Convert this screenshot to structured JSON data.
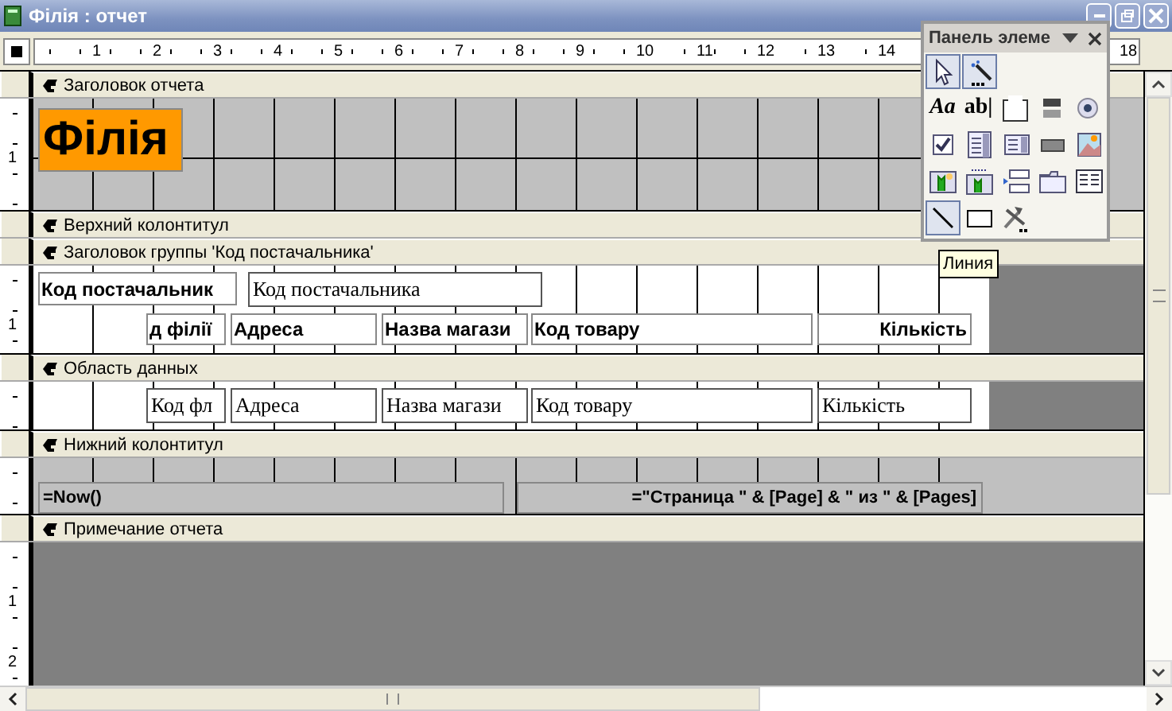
{
  "window": {
    "title": "Філія : отчет"
  },
  "ruler": {
    "marks": [
      "1",
      "2",
      "3",
      "4",
      "5",
      "6",
      "7",
      "8",
      "9",
      "10",
      "11",
      "12",
      "13",
      "14",
      "18"
    ]
  },
  "sections": [
    {
      "title": "Заголовок отчета",
      "kind": "shaded",
      "ruler_marks": [
        "1"
      ],
      "controls": [
        {
          "kind": "title",
          "text": "Філія"
        }
      ]
    },
    {
      "title": "Верхний колонтитул"
    },
    {
      "title": "Заголовок группы 'Код постачальника'",
      "kind": "plain",
      "ruler_marks": [
        "1"
      ],
      "controls": [
        {
          "kind": "label",
          "text": "Код постачальник"
        },
        {
          "kind": "textbox",
          "text": "Код постачальника"
        },
        {
          "kind": "label",
          "text": "д філії"
        },
        {
          "kind": "label",
          "text": "Адреса"
        },
        {
          "kind": "label",
          "text": "Назва магази"
        },
        {
          "kind": "label",
          "text": "Код товару"
        },
        {
          "kind": "label_right",
          "text": "Кількість"
        }
      ]
    },
    {
      "title": "Область данных",
      "kind": "plain",
      "controls": [
        {
          "kind": "textbox",
          "text": "Код фл"
        },
        {
          "kind": "textbox",
          "text": "Адреса"
        },
        {
          "kind": "textbox",
          "text": "Назва магази"
        },
        {
          "kind": "textbox",
          "text": "Код товару"
        },
        {
          "kind": "textbox",
          "text": "Кількість"
        }
      ]
    },
    {
      "title": "Нижний колонтитул",
      "kind": "shaded",
      "controls": [
        {
          "kind": "expression",
          "text": "=Now()"
        },
        {
          "kind": "expression_right",
          "text": "=\"Страница \" & [Page] & \" из \" & [Pages]"
        }
      ]
    },
    {
      "title": "Примечание отчета",
      "kind": "empty",
      "ruler_marks": [
        "1",
        "2"
      ]
    }
  ],
  "toolbox": {
    "title": "Панель элеме",
    "tools": [
      {
        "kind": "pointer",
        "selected": true
      },
      {
        "kind": "wizard",
        "selected": true
      },
      {
        "kind": "glyph",
        "glyph": "Aa",
        "selected": false
      },
      {
        "kind": "glyph",
        "glyph": "ab|",
        "selected": false
      },
      {
        "kind": "group",
        "selected": false
      },
      {
        "kind": "toggle",
        "selected": false
      },
      {
        "kind": "radio",
        "selected": false
      },
      {
        "kind": "checkbox",
        "selected": false
      },
      {
        "kind": "combo",
        "selected": false
      },
      {
        "kind": "list",
        "selected": false
      },
      {
        "kind": "button",
        "selected": false
      },
      {
        "kind": "image",
        "selected": false
      },
      {
        "kind": "unbound",
        "selected": false
      },
      {
        "kind": "bound",
        "selected": false
      },
      {
        "kind": "pagebreak",
        "selected": false
      },
      {
        "kind": "tabs",
        "selected": false
      },
      {
        "kind": "subform",
        "selected": false
      },
      {
        "kind": "line",
        "selected": true
      },
      {
        "kind": "rect",
        "selected": false
      },
      {
        "kind": "more",
        "selected": false
      }
    ]
  },
  "tooltip": {
    "text": "Линия"
  }
}
